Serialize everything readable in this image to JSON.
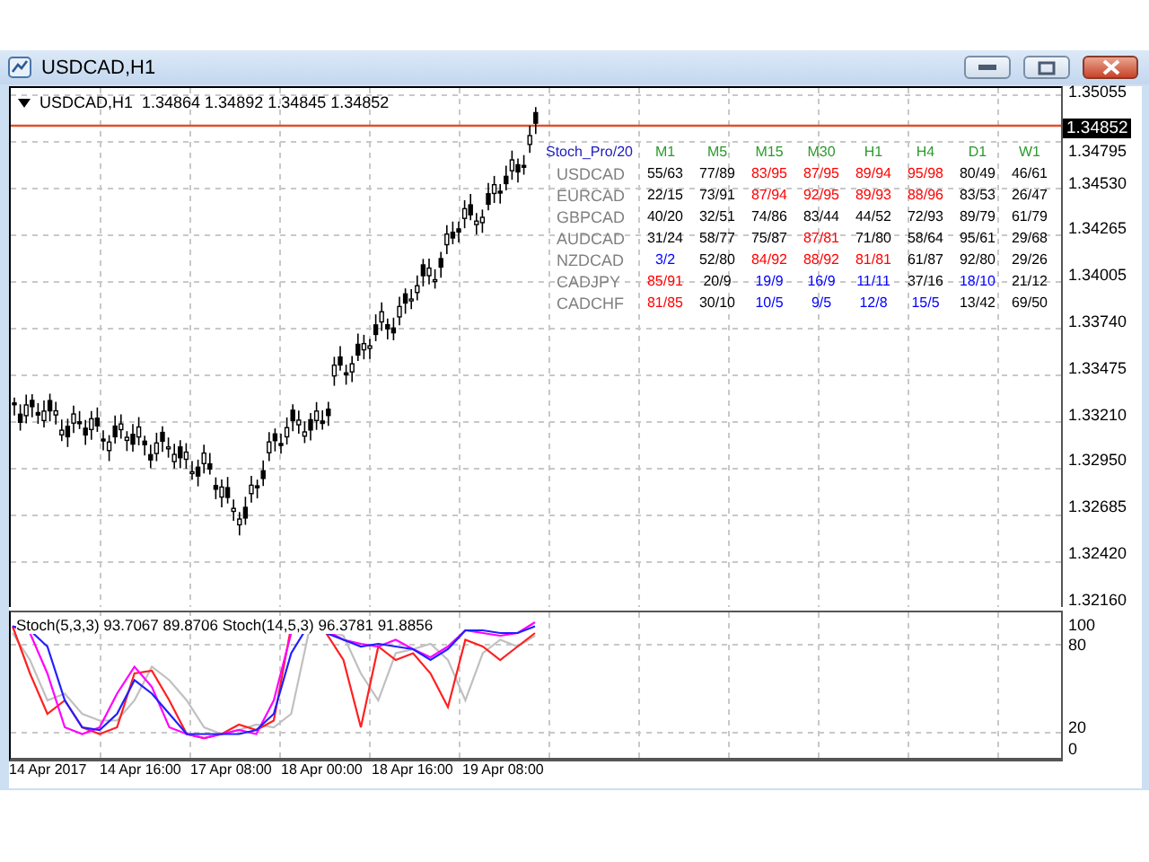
{
  "window": {
    "title": "USDCAD,H1"
  },
  "chart": {
    "symbol": "USDCAD,H1",
    "quotes": "1.34864 1.34892 1.34845 1.34852",
    "current_price": "1.34852",
    "price_ticks": [
      "1.35055",
      "1.34795",
      "1.34530",
      "1.34265",
      "1.34005",
      "1.33740",
      "1.33475",
      "1.33210",
      "1.32950",
      "1.32685",
      "1.32420",
      "1.32160"
    ],
    "time_labels": [
      "14 Apr 2017",
      "14 Apr 16:00",
      "17 Apr 08:00",
      "18 Apr 00:00",
      "18 Apr 16:00",
      "19 Apr 08:00"
    ]
  },
  "indicator": {
    "legend": "Stoch(5,3,3) 93.7067 89.8706  Stoch(14,5,3) 96.3781 91.8856",
    "ticks": [
      "100",
      "80",
      "20",
      "0"
    ]
  },
  "stoch_table": {
    "title": "Stoch_Pro/20",
    "columns": [
      "M1",
      "M5",
      "M15",
      "M30",
      "H1",
      "H4",
      "D1",
      "W1"
    ],
    "rows": [
      {
        "symbol": "USDCAD",
        "cells": [
          {
            "text": "55/63",
            "color": "#000000"
          },
          {
            "text": "77/89",
            "color": "#000000"
          },
          {
            "text": "83/95",
            "color": "#ff0000"
          },
          {
            "text": "87/95",
            "color": "#ff0000"
          },
          {
            "text": "89/94",
            "color": "#ff0000"
          },
          {
            "text": "95/98",
            "color": "#ff0000"
          },
          {
            "text": "80/49",
            "color": "#000000"
          },
          {
            "text": "46/61",
            "color": "#000000"
          }
        ]
      },
      {
        "symbol": "EURCAD",
        "cells": [
          {
            "text": "22/15",
            "color": "#000000"
          },
          {
            "text": "73/91",
            "color": "#000000"
          },
          {
            "text": "87/94",
            "color": "#ff0000"
          },
          {
            "text": "92/95",
            "color": "#ff0000"
          },
          {
            "text": "89/93",
            "color": "#ff0000"
          },
          {
            "text": "88/96",
            "color": "#ff0000"
          },
          {
            "text": "83/53",
            "color": "#000000"
          },
          {
            "text": "26/47",
            "color": "#000000"
          }
        ]
      },
      {
        "symbol": "GBPCAD",
        "cells": [
          {
            "text": "40/20",
            "color": "#000000"
          },
          {
            "text": "32/51",
            "color": "#000000"
          },
          {
            "text": "74/86",
            "color": "#000000"
          },
          {
            "text": "83/44",
            "color": "#000000"
          },
          {
            "text": "44/52",
            "color": "#000000"
          },
          {
            "text": "72/93",
            "color": "#000000"
          },
          {
            "text": "89/79",
            "color": "#000000"
          },
          {
            "text": "61/79",
            "color": "#000000"
          }
        ]
      },
      {
        "symbol": "AUDCAD",
        "cells": [
          {
            "text": "31/24",
            "color": "#000000"
          },
          {
            "text": "58/77",
            "color": "#000000"
          },
          {
            "text": "75/87",
            "color": "#000000"
          },
          {
            "text": "87/81",
            "color": "#ff0000"
          },
          {
            "text": "71/80",
            "color": "#000000"
          },
          {
            "text": "58/64",
            "color": "#000000"
          },
          {
            "text": "95/61",
            "color": "#000000"
          },
          {
            "text": "29/68",
            "color": "#000000"
          }
        ]
      },
      {
        "symbol": "NZDCAD",
        "cells": [
          {
            "text": "3/2",
            "color": "#0000ff"
          },
          {
            "text": "52/80",
            "color": "#000000"
          },
          {
            "text": "84/92",
            "color": "#ff0000"
          },
          {
            "text": "88/92",
            "color": "#ff0000"
          },
          {
            "text": "81/81",
            "color": "#ff0000"
          },
          {
            "text": "61/87",
            "color": "#000000"
          },
          {
            "text": "92/80",
            "color": "#000000"
          },
          {
            "text": "29/26",
            "color": "#000000"
          }
        ]
      },
      {
        "symbol": "CADJPY",
        "cells": [
          {
            "text": "85/91",
            "color": "#ff0000"
          },
          {
            "text": "20/9",
            "color": "#000000"
          },
          {
            "text": "19/9",
            "color": "#0000ff"
          },
          {
            "text": "16/9",
            "color": "#0000ff"
          },
          {
            "text": "11/11",
            "color": "#0000ff"
          },
          {
            "text": "37/16",
            "color": "#000000"
          },
          {
            "text": "18/10",
            "color": "#0000ff"
          },
          {
            "text": "21/12",
            "color": "#000000"
          }
        ]
      },
      {
        "symbol": "CADCHF",
        "cells": [
          {
            "text": "81/85",
            "color": "#ff0000"
          },
          {
            "text": "30/10",
            "color": "#000000"
          },
          {
            "text": "10/5",
            "color": "#0000ff"
          },
          {
            "text": "9/5",
            "color": "#0000ff"
          },
          {
            "text": "12/8",
            "color": "#0000ff"
          },
          {
            "text": "15/5",
            "color": "#0000ff"
          },
          {
            "text": "13/42",
            "color": "#000000"
          },
          {
            "text": "69/50",
            "color": "#000000"
          }
        ]
      }
    ]
  }
}
